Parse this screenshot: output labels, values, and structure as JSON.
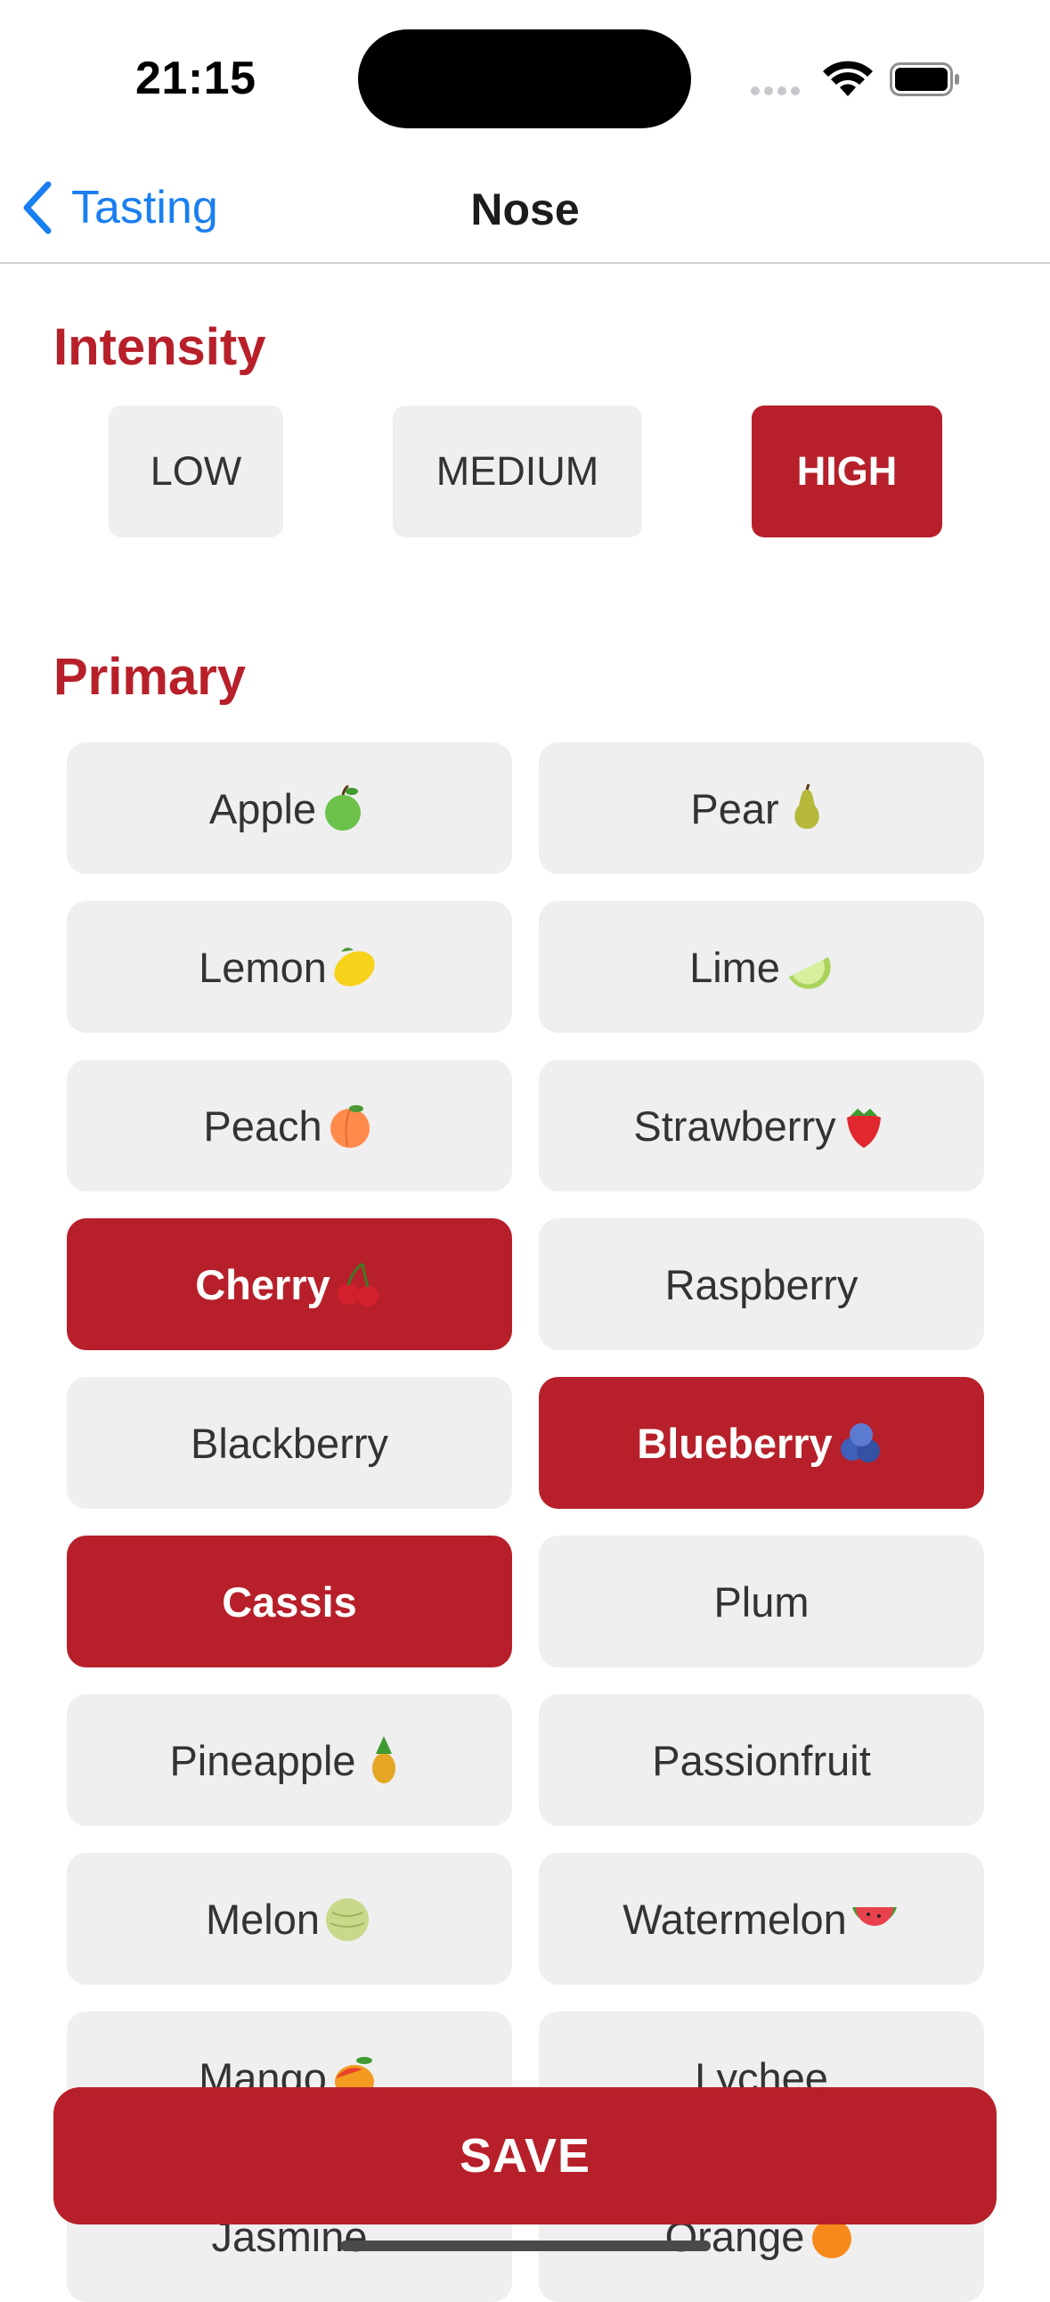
{
  "status_bar": {
    "time": "21:15"
  },
  "nav": {
    "back_label": "Tasting",
    "title": "Nose"
  },
  "intensity": {
    "heading": "Intensity",
    "options": [
      "LOW",
      "MEDIUM",
      "HIGH"
    ],
    "selected": "HIGH"
  },
  "primary": {
    "heading": "Primary",
    "items": [
      {
        "label": "Apple",
        "icon": "green-apple-icon",
        "selected": false
      },
      {
        "label": "Pear",
        "icon": "pear-icon",
        "selected": false
      },
      {
        "label": "Lemon",
        "icon": "lemon-icon",
        "selected": false
      },
      {
        "label": "Lime",
        "icon": "lime-icon",
        "selected": false
      },
      {
        "label": "Peach",
        "icon": "peach-icon",
        "selected": false
      },
      {
        "label": "Strawberry",
        "icon": "strawberry-icon",
        "selected": false
      },
      {
        "label": "Cherry",
        "icon": "cherries-icon",
        "selected": true
      },
      {
        "label": "Raspberry",
        "icon": "",
        "selected": false
      },
      {
        "label": "Blackberry",
        "icon": "",
        "selected": false
      },
      {
        "label": "Blueberry",
        "icon": "blueberries-icon",
        "selected": true
      },
      {
        "label": "Cassis",
        "icon": "",
        "selected": true
      },
      {
        "label": "Plum",
        "icon": "",
        "selected": false
      },
      {
        "label": "Pineapple",
        "icon": "pineapple-icon",
        "selected": false
      },
      {
        "label": "Passionfruit",
        "icon": "",
        "selected": false
      },
      {
        "label": "Melon",
        "icon": "melon-icon",
        "selected": false
      },
      {
        "label": "Watermelon",
        "icon": "watermelon-icon",
        "selected": false
      },
      {
        "label": "Mango",
        "icon": "mango-icon",
        "selected": false
      },
      {
        "label": "Lychee",
        "icon": "",
        "selected": false
      },
      {
        "label": "Jasmine",
        "icon": "",
        "selected": false
      },
      {
        "label": "Orange",
        "icon": "orange-icon",
        "selected": false
      }
    ]
  },
  "save_label": "SAVE",
  "colors": {
    "accent": "#b7202a",
    "link": "#1a7ff0",
    "chip": "#efefef"
  }
}
